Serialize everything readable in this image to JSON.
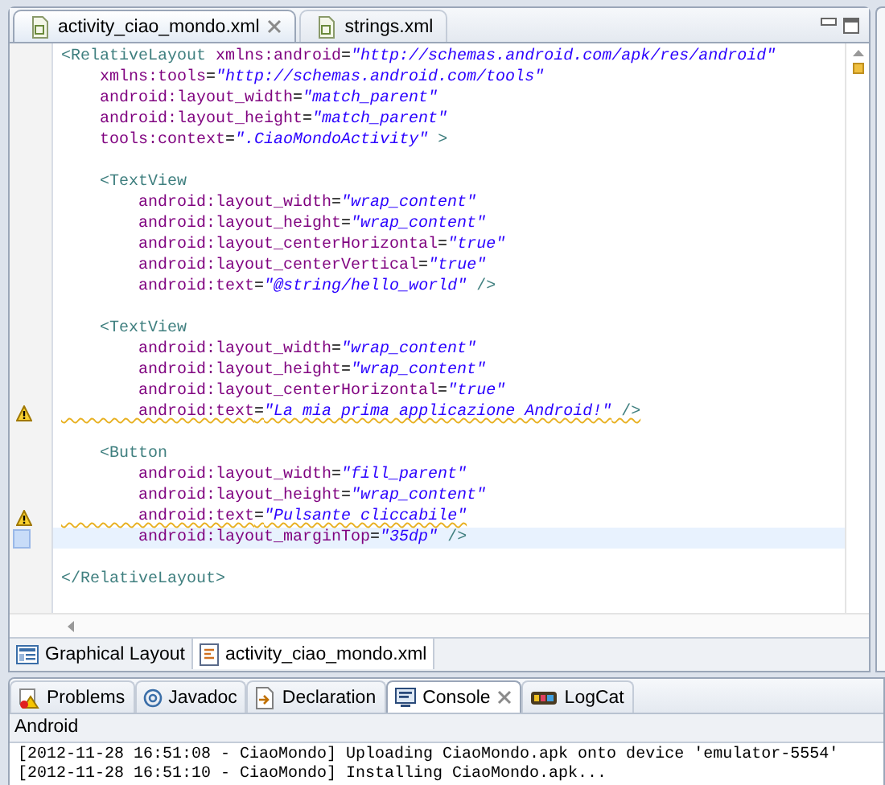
{
  "editor_tabs": [
    {
      "label": "activity_ciao_mondo.xml",
      "selected": true
    },
    {
      "label": "strings.xml",
      "selected": false
    }
  ],
  "code_lines": [
    {
      "warning": false,
      "current": false,
      "tokens": [
        {
          "kind": "tag",
          "text": "<RelativeLayout"
        },
        {
          "kind": "attr",
          "text": " xmlns:android"
        },
        {
          "kind": "punct",
          "text": "="
        },
        {
          "kind": "value",
          "text": "\"http://schemas.android.com/apk/res/android\""
        }
      ]
    },
    {
      "warning": false,
      "current": false,
      "tokens": [
        {
          "kind": "attr",
          "text": "    xmlns:tools"
        },
        {
          "kind": "punct",
          "text": "="
        },
        {
          "kind": "value",
          "text": "\"http://schemas.android.com/tools\""
        }
      ]
    },
    {
      "warning": false,
      "current": false,
      "tokens": [
        {
          "kind": "attr",
          "text": "    android:layout_width"
        },
        {
          "kind": "punct",
          "text": "="
        },
        {
          "kind": "value",
          "text": "\"match_parent\""
        }
      ]
    },
    {
      "warning": false,
      "current": false,
      "tokens": [
        {
          "kind": "attr",
          "text": "    android:layout_height"
        },
        {
          "kind": "punct",
          "text": "="
        },
        {
          "kind": "value",
          "text": "\"match_parent\""
        }
      ]
    },
    {
      "warning": false,
      "current": false,
      "tokens": [
        {
          "kind": "attr",
          "text": "    tools:context"
        },
        {
          "kind": "punct",
          "text": "="
        },
        {
          "kind": "value",
          "text": "\".CiaoMondoActivity\""
        },
        {
          "kind": "tag",
          "text": " >"
        }
      ]
    },
    {
      "warning": false,
      "current": false
    },
    {
      "warning": false,
      "current": false,
      "tokens": [
        {
          "kind": "tag",
          "text": "    <TextView"
        }
      ]
    },
    {
      "warning": false,
      "current": false,
      "tokens": [
        {
          "kind": "attr",
          "text": "        android:layout_width"
        },
        {
          "kind": "punct",
          "text": "="
        },
        {
          "kind": "value",
          "text": "\"wrap_content\""
        }
      ]
    },
    {
      "warning": false,
      "current": false,
      "tokens": [
        {
          "kind": "attr",
          "text": "        android:layout_height"
        },
        {
          "kind": "punct",
          "text": "="
        },
        {
          "kind": "value",
          "text": "\"wrap_content\""
        }
      ]
    },
    {
      "warning": false,
      "current": false,
      "tokens": [
        {
          "kind": "attr",
          "text": "        android:layout_centerHorizontal"
        },
        {
          "kind": "punct",
          "text": "="
        },
        {
          "kind": "value",
          "text": "\"true\""
        }
      ]
    },
    {
      "warning": false,
      "current": false,
      "tokens": [
        {
          "kind": "attr",
          "text": "        android:layout_centerVertical"
        },
        {
          "kind": "punct",
          "text": "="
        },
        {
          "kind": "value",
          "text": "\"true\""
        }
      ]
    },
    {
      "warning": false,
      "current": false,
      "tokens": [
        {
          "kind": "attr",
          "text": "        android:text"
        },
        {
          "kind": "punct",
          "text": "="
        },
        {
          "kind": "value",
          "text": "\"@string/hello_world\""
        },
        {
          "kind": "tag",
          "text": " />"
        }
      ]
    },
    {
      "warning": false,
      "current": false
    },
    {
      "warning": false,
      "current": false,
      "tokens": [
        {
          "kind": "tag",
          "text": "    <TextView"
        }
      ]
    },
    {
      "warning": false,
      "current": false,
      "tokens": [
        {
          "kind": "attr",
          "text": "        android:layout_width"
        },
        {
          "kind": "punct",
          "text": "="
        },
        {
          "kind": "value",
          "text": "\"wrap_content\""
        }
      ]
    },
    {
      "warning": false,
      "current": false,
      "tokens": [
        {
          "kind": "attr",
          "text": "        android:layout_height"
        },
        {
          "kind": "punct",
          "text": "="
        },
        {
          "kind": "value",
          "text": "\"wrap_content\""
        }
      ]
    },
    {
      "warning": false,
      "current": false,
      "tokens": [
        {
          "kind": "attr",
          "text": "        android:layout_centerHorizontal"
        },
        {
          "kind": "punct",
          "text": "="
        },
        {
          "kind": "value",
          "text": "\"true\""
        }
      ]
    },
    {
      "warning": true,
      "current": false,
      "tokens": [
        {
          "kind": "attr",
          "text": "        android:text"
        },
        {
          "kind": "punct",
          "text": "="
        },
        {
          "kind": "value",
          "text": "\"La mia prima applicazione Android!\""
        },
        {
          "kind": "tag",
          "text": " />"
        }
      ]
    },
    {
      "warning": false,
      "current": false
    },
    {
      "warning": false,
      "current": false,
      "tokens": [
        {
          "kind": "tag",
          "text": "    <Button"
        }
      ]
    },
    {
      "warning": false,
      "current": false,
      "tokens": [
        {
          "kind": "attr",
          "text": "        android:layout_width"
        },
        {
          "kind": "punct",
          "text": "="
        },
        {
          "kind": "value",
          "text": "\"fill_parent\""
        }
      ]
    },
    {
      "warning": false,
      "current": false,
      "tokens": [
        {
          "kind": "attr",
          "text": "        android:layout_height"
        },
        {
          "kind": "punct",
          "text": "="
        },
        {
          "kind": "value",
          "text": "\"wrap_content\""
        }
      ]
    },
    {
      "warning": true,
      "current": false,
      "tokens": [
        {
          "kind": "attr",
          "text": "        android:text"
        },
        {
          "kind": "punct",
          "text": "="
        },
        {
          "kind": "value",
          "text": "\"Pulsante cliccabile\""
        }
      ]
    },
    {
      "warning": false,
      "current": true,
      "tokens": [
        {
          "kind": "attr",
          "text": "        android:layout_marginTop"
        },
        {
          "kind": "punct",
          "text": "="
        },
        {
          "kind": "value",
          "text": "\"35dp\""
        },
        {
          "kind": "tag",
          "text": " />"
        }
      ]
    },
    {
      "warning": false,
      "current": false
    },
    {
      "warning": false,
      "current": false,
      "tokens": [
        {
          "kind": "tag",
          "text": "</RelativeLayout>"
        }
      ]
    }
  ],
  "editor_mode_tabs": [
    {
      "label": "Graphical Layout",
      "kind": "layout",
      "selected": false
    },
    {
      "label": "activity_ciao_mondo.xml",
      "kind": "source",
      "selected": true
    }
  ],
  "bottom_tabs": [
    {
      "label": "Problems",
      "kind": "problems",
      "selected": false
    },
    {
      "label": "Javadoc",
      "kind": "javadoc",
      "selected": false
    },
    {
      "label": "Declaration",
      "kind": "declaration",
      "selected": false
    },
    {
      "label": "Console",
      "kind": "console",
      "selected": true
    },
    {
      "label": "LogCat",
      "kind": "logcat",
      "selected": false
    }
  ],
  "console_name": "Android",
  "console_lines": [
    "[2012-11-28 16:51:08 - CiaoMondo] Uploading CiaoMondo.apk onto device 'emulator-5554'",
    "[2012-11-28 16:51:10 - CiaoMondo] Installing CiaoMondo.apk..."
  ]
}
